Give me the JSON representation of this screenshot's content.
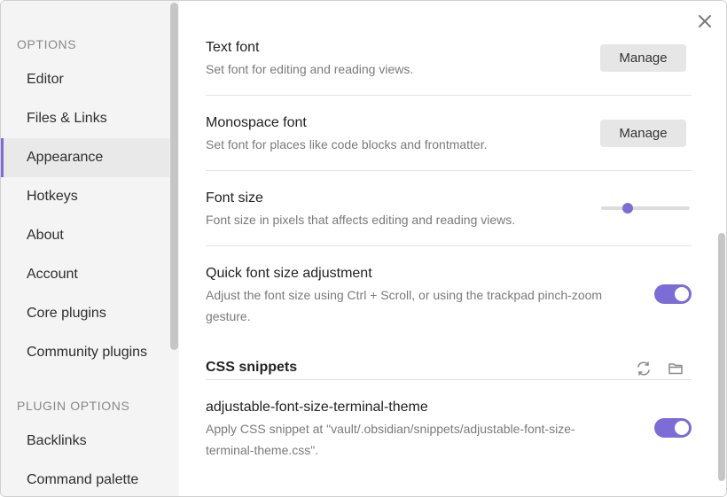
{
  "sidebar": {
    "options_heading": "OPTIONS",
    "items": [
      {
        "label": "Editor"
      },
      {
        "label": "Files & Links"
      },
      {
        "label": "Appearance"
      },
      {
        "label": "Hotkeys"
      },
      {
        "label": "About"
      },
      {
        "label": "Account"
      },
      {
        "label": "Core plugins"
      },
      {
        "label": "Community plugins"
      }
    ],
    "plugin_heading": "PLUGIN OPTIONS",
    "plugin_items": [
      {
        "label": "Backlinks"
      },
      {
        "label": "Command palette"
      }
    ],
    "active_item": "Appearance"
  },
  "settings": {
    "text_font": {
      "name": "Text font",
      "desc": "Set font for editing and reading views.",
      "button": "Manage"
    },
    "mono_font": {
      "name": "Monospace font",
      "desc": "Set font for places like code blocks and frontmatter.",
      "button": "Manage"
    },
    "font_size": {
      "name": "Font size",
      "desc": "Font size in pixels that affects editing and reading views.",
      "slider_fraction": 0.3
    },
    "quick_font": {
      "name": "Quick font size adjustment",
      "desc_line1": "Adjust the font size using Ctrl + Scroll, or using the trackpad pinch-zoom",
      "desc_line2": "gesture.",
      "enabled": true
    }
  },
  "css_snippets": {
    "title": "CSS snippets",
    "reload_icon": "reload-icon",
    "folder_icon": "folder-icon",
    "items": [
      {
        "name": "adjustable-font-size-terminal-theme",
        "desc_line1": "Apply CSS snippet at \"vault/.obsidian/snippets/adjustable-font-size-",
        "desc_line2": "terminal-theme.css\".",
        "enabled": true
      }
    ]
  },
  "colors": {
    "accent": "#7c6cd6",
    "sidebar_bg": "#f4f4f4",
    "active_bg": "#e9e9e9"
  }
}
